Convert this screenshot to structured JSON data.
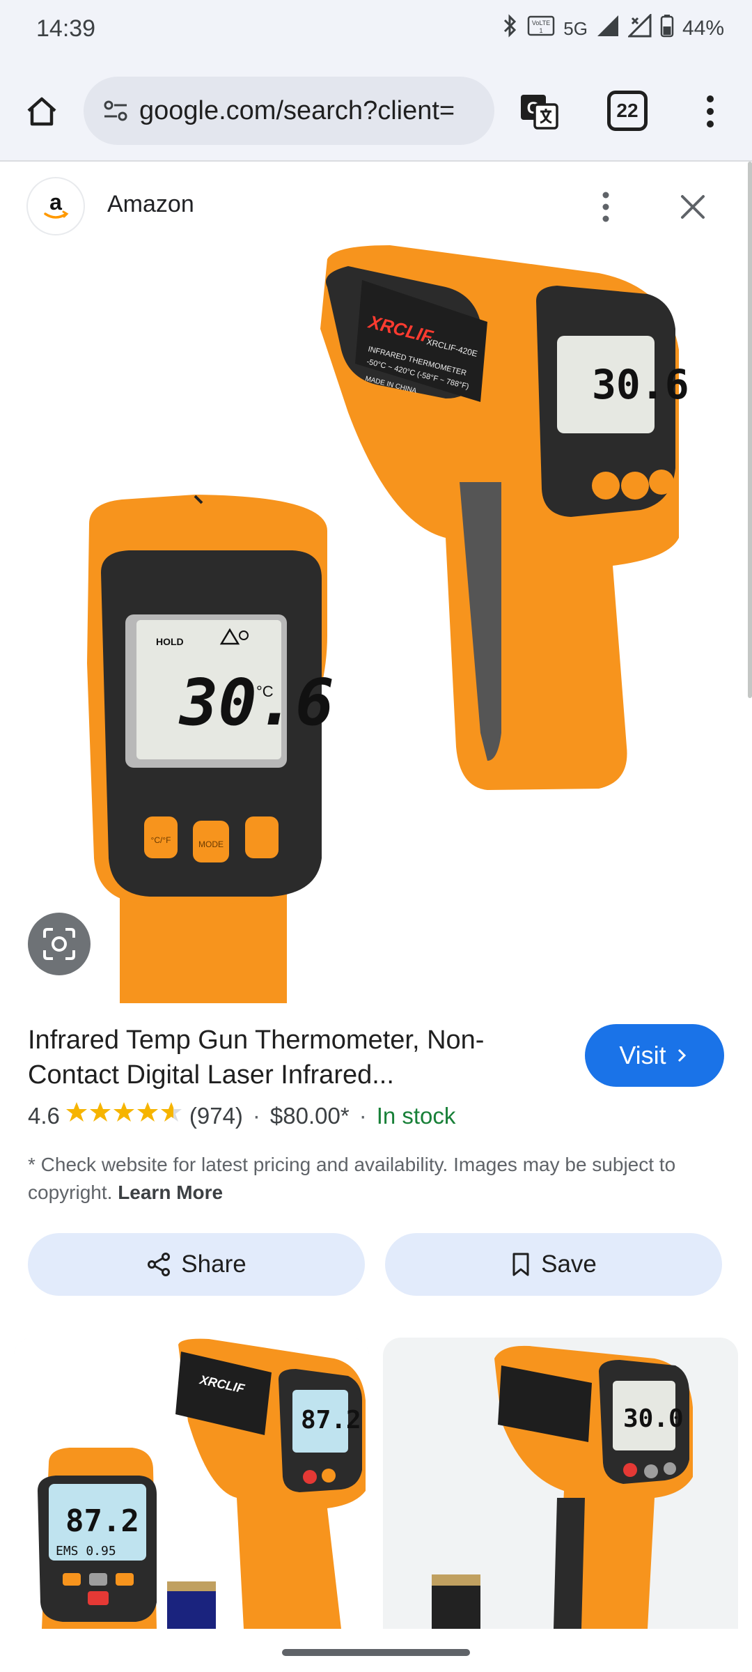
{
  "status": {
    "time": "14:39",
    "battery": "44%",
    "network": "5G"
  },
  "browser": {
    "url": "google.com/search?client=",
    "tab_count": "22"
  },
  "panel": {
    "source": "Amazon"
  },
  "product": {
    "title": "Infrared Temp Gun Thermometer, Non-Contact Digital Laser Infrared...",
    "visit_label": "Visit",
    "rating": "4.6",
    "stars": 4.6,
    "review_count": "(974)",
    "price": "$80.00*",
    "availability": "In stock",
    "disclaimer": "* Check website for latest pricing and availability. Images may be subject to copyright.",
    "learn_more": "Learn More",
    "share_label": "Share",
    "save_label": "Save"
  },
  "device": {
    "brand": "XRCLIF",
    "model": "XRCLIF-420E",
    "label_line1": "INFRARED THERMOMETER",
    "label_line2": "-50°C ~ 420°C (-58°F ~ 788°F)",
    "made_in": "MADE IN CHINA",
    "reading": "30.6",
    "unit": "°C",
    "hold": "HOLD",
    "btn_left": "°C/°F",
    "btn_mid": "MODE",
    "related_reading": "87.2",
    "related_ems": "EMS 0.95",
    "related_reading_2": "30.0"
  },
  "colors": {
    "accent": "#1a73e8",
    "orange": "#f7941d",
    "in_stock": "#188038",
    "star": "#f6b400"
  }
}
